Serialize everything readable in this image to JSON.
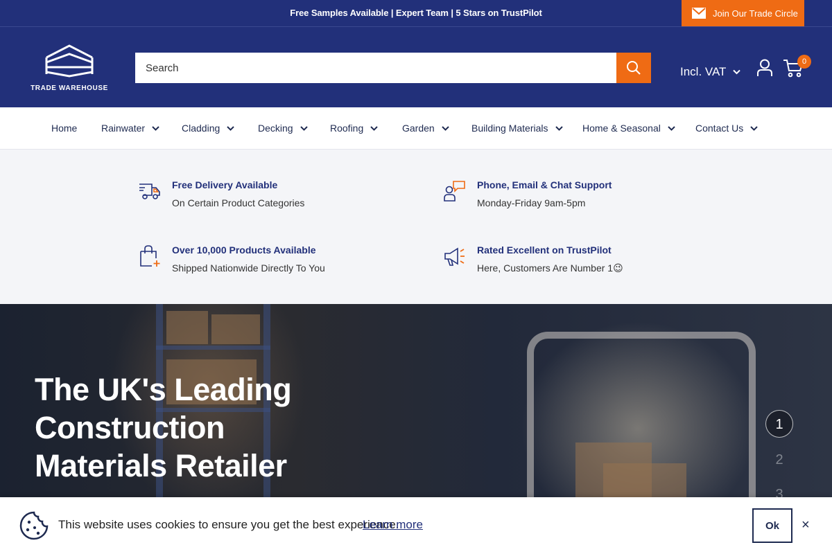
{
  "announcement": {
    "message": "Free Samples Available | Expert Team | 5 Stars on TrustPilot",
    "trade_button": "Join Our Trade Circle",
    "trade_icon": "envelope-icon"
  },
  "header": {
    "logo_text": "TRADE WAREHOUSE",
    "search_placeholder": "Search",
    "vat_label": "Incl. VAT",
    "cart_count": "0"
  },
  "nav": {
    "items": [
      {
        "label": "Home"
      },
      {
        "label": "Rainwater"
      },
      {
        "label": "Cladding"
      },
      {
        "label": "Decking"
      },
      {
        "label": "Roofing"
      },
      {
        "label": "Garden"
      },
      {
        "label": "Building Materials"
      },
      {
        "label": "Home & Seasonal"
      },
      {
        "label": "Contact Us"
      }
    ]
  },
  "features": [
    {
      "icon": "delivery-truck-icon",
      "title": "Free Delivery Available",
      "subtitle": "On Certain Product Categories"
    },
    {
      "icon": "support-chat-icon",
      "title": "Phone, Email & Chat Support",
      "subtitle": "Monday-Friday 9am-5pm"
    },
    {
      "icon": "shopping-bag-icon",
      "title": "Over 10,000 Products Available",
      "subtitle": "Shipped Nationwide Directly To You"
    },
    {
      "icon": "megaphone-icon",
      "title": "Rated Excellent on TrustPilot",
      "subtitle": "Here, Customers Are Number 1😉"
    }
  ],
  "hero": {
    "title": "The UK's Leading Construction Materials Retailer",
    "slides": [
      "1",
      "2",
      "3"
    ],
    "active_slide": "1"
  },
  "cookie": {
    "message": "This website uses cookies to ensure you get the best experience.",
    "learn_more": "Learn more",
    "ok_label": "Ok",
    "close_label": "×"
  },
  "colors": {
    "brand_navy": "#22307a",
    "accent_orange": "#ef6b14"
  }
}
